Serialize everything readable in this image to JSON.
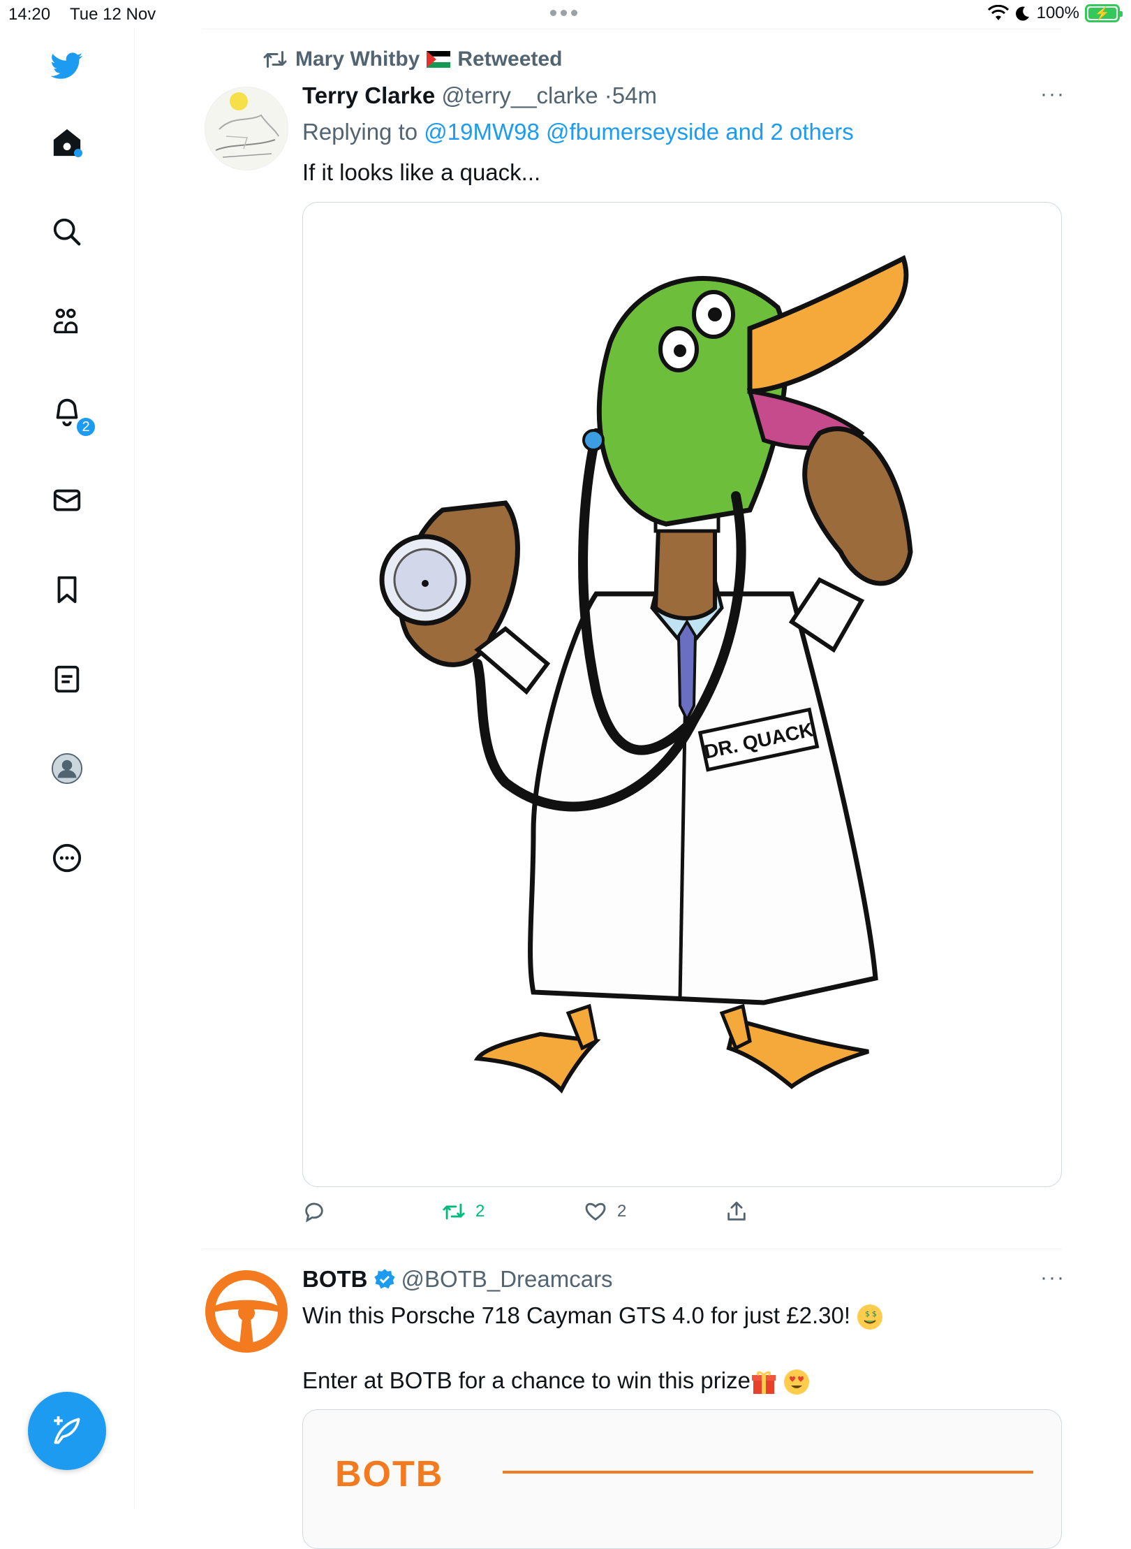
{
  "status_bar": {
    "time": "14:20",
    "date": "Tue 12 Nov",
    "battery": "100%"
  },
  "sidebar": {
    "items": [
      {
        "icon": "twitter-bird-icon"
      },
      {
        "icon": "home-icon"
      },
      {
        "icon": "search-icon"
      },
      {
        "icon": "communities-icon"
      },
      {
        "icon": "notifications-icon",
        "badge": "2"
      },
      {
        "icon": "messages-icon"
      },
      {
        "icon": "bookmarks-icon"
      },
      {
        "icon": "lists-icon"
      },
      {
        "icon": "profile-icon"
      },
      {
        "icon": "more-icon"
      }
    ],
    "compose_icon": "compose-tweet-icon"
  },
  "tweet1": {
    "retweeted_by": "Mary Whitby",
    "retweeted_label": "Retweeted",
    "author_name": "Terry Clarke",
    "author_handle": "@terry__clarke",
    "time": "54m",
    "replying_prefix": "Replying to",
    "replying_to": "@19MW98 @fbumerseyside and 2 others",
    "text": "If it looks like a quack...",
    "image_label": "DR. QUACK",
    "retweets": "2",
    "likes": "2"
  },
  "tweet2": {
    "author_name": "BOTB",
    "author_handle": "@BOTB_Dreamcars",
    "text1": "Win this Porsche 718 Cayman GTS 4.0 for just £2.30!",
    "text2": "Enter at BOTB for a chance to win this prize",
    "media_logo": "BOTB"
  },
  "colors": {
    "accent": "#1d9bf0",
    "retweet_green": "#00ba7c",
    "botb_orange": "#f47a20",
    "muted": "#536471"
  }
}
